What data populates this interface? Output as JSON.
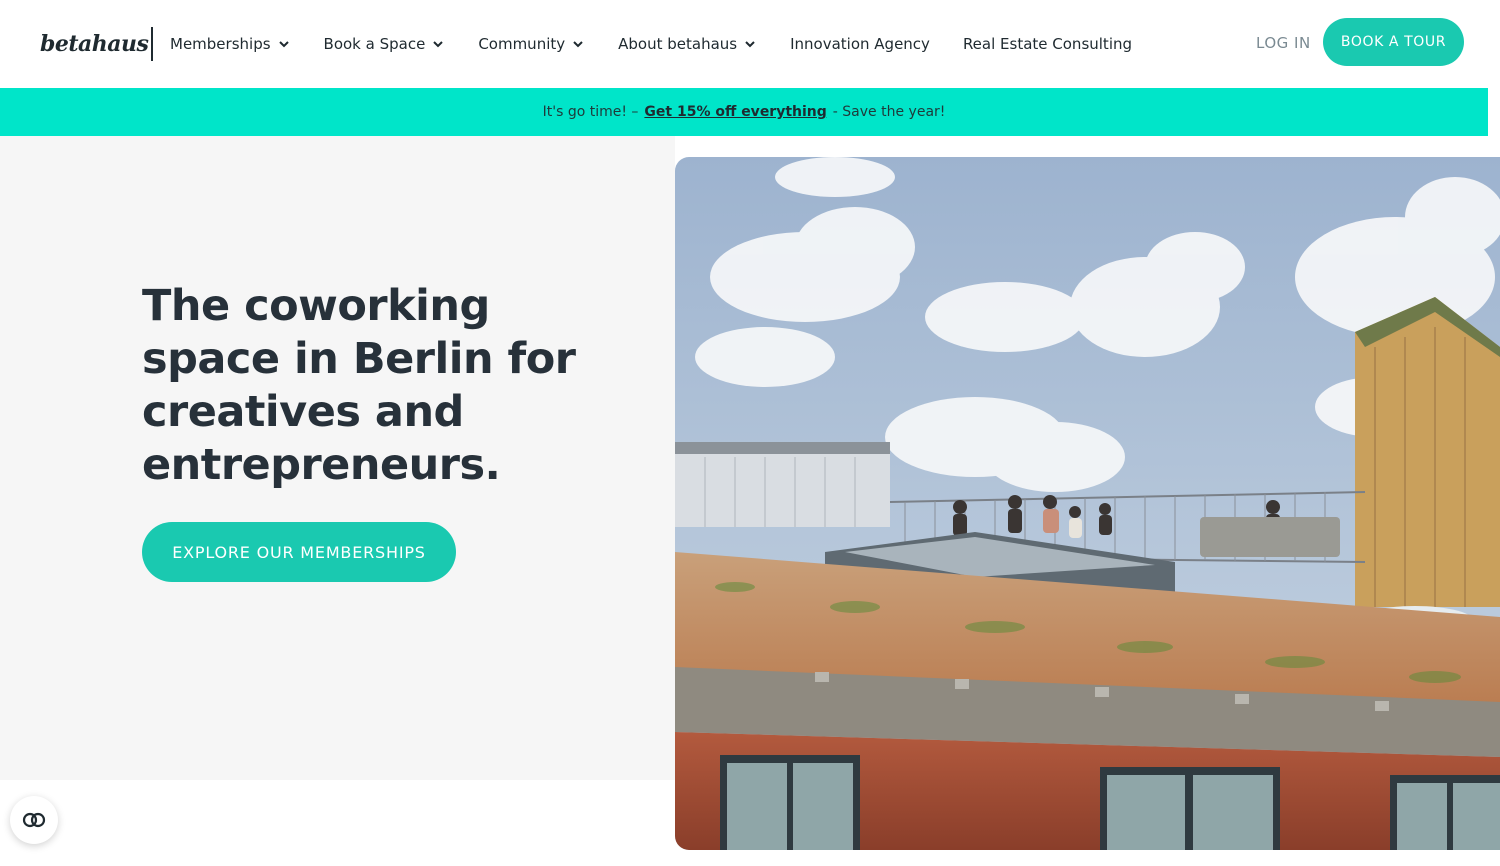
{
  "header": {
    "logo_text": "betahaus",
    "nav": [
      {
        "label": "Memberships",
        "has_dropdown": true
      },
      {
        "label": "Book a Space",
        "has_dropdown": true
      },
      {
        "label": "Community",
        "has_dropdown": true
      },
      {
        "label": "About betahaus",
        "has_dropdown": true
      },
      {
        "label": "Innovation Agency",
        "has_dropdown": false
      },
      {
        "label": "Real Estate Consulting",
        "has_dropdown": false
      }
    ],
    "login_label": "LOG IN",
    "tour_label": "BOOK A TOUR"
  },
  "promo": {
    "prefix": "It's go time! –",
    "link": "Get 15% off everything",
    "suffix": "- Save the year!"
  },
  "hero": {
    "title": "The coworking space in Berlin for creatives and entrepreneurs.",
    "cta_label": "EXPLORE OUR MEMBERSHIPS",
    "image_icon": "rooftop-terrace-photo"
  },
  "accessibility": {
    "icon": "accessibility-icon"
  },
  "colors": {
    "accent": "#1ac9b0",
    "promo_bar": "#00e5c9",
    "text_dark": "#27313a",
    "hero_bg": "#f6f6f6",
    "login_gray": "#7a8a92"
  }
}
